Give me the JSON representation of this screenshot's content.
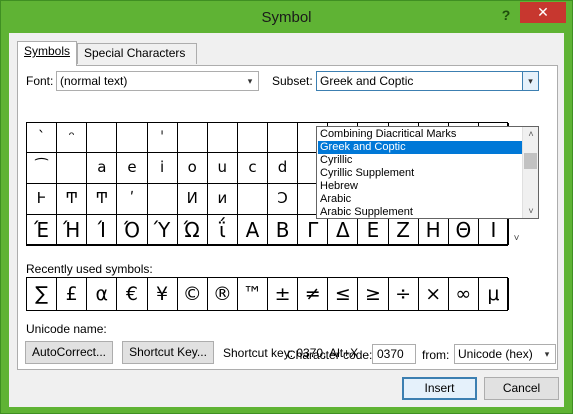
{
  "window": {
    "title": "Symbol",
    "help": "?",
    "close": "✕"
  },
  "tabs": {
    "symbols": "Symbols",
    "special": "Special Characters"
  },
  "font": {
    "label": "Font:",
    "value": "(normal text)"
  },
  "subset": {
    "label": "Subset:",
    "value": "Greek and Coptic",
    "options": [
      "Combining Diacritical Marks",
      "Greek and Coptic",
      "Cyrillic",
      "Cyrillic Supplement",
      "Hebrew",
      "Arabic",
      "Arabic Supplement"
    ],
    "selected_index": 1
  },
  "grid": {
    "rows": [
      [
        "ˋ",
        "ᵔ",
        "",
        "",
        "ˈ",
        "",
        "",
        "",
        "",
        "",
        "",
        "",
        "",
        "",
        "",
        ""
      ],
      [
        "⁀",
        "",
        "a",
        "e",
        "i",
        "o",
        "u",
        "c",
        "d",
        "",
        "",
        "",
        "",
        "",
        "",
        ""
      ],
      [
        "Ͱ",
        "Ͳ",
        "Ͳ",
        "ʹ",
        "",
        "Ͷ",
        "ͷ",
        "",
        "Ͻ",
        "",
        "",
        "",
        "",
        "",
        "",
        ""
      ],
      [
        "Έ",
        "Ή",
        "Ί",
        "Ό",
        "Ύ",
        "Ώ",
        "ΐ",
        "Α",
        "Β",
        "Γ",
        "Δ",
        "Ε",
        "Ζ",
        "Η",
        "Θ",
        "Ι"
      ]
    ]
  },
  "recent": {
    "label": "Recently used symbols:",
    "symbols": [
      "∑",
      "£",
      "α",
      "€",
      "¥",
      "©",
      "®",
      "™",
      "±",
      "≠",
      "≤",
      "≥",
      "÷",
      "×",
      "∞",
      "μ"
    ]
  },
  "unicode": {
    "label": "Unicode name:"
  },
  "charcode": {
    "label": "Character code:",
    "value": "0370",
    "from_label": "from:",
    "from_value": "Unicode (hex)"
  },
  "buttons": {
    "autocorrect": "AutoCorrect...",
    "shortcut": "Shortcut Key...",
    "shortcut_text": "Shortcut key: 0370, Alt+X",
    "insert": "Insert",
    "cancel": "Cancel"
  },
  "icons": {
    "dropdown_arrow": "▾",
    "scroll_up": "˄",
    "scroll_down": "˅"
  }
}
